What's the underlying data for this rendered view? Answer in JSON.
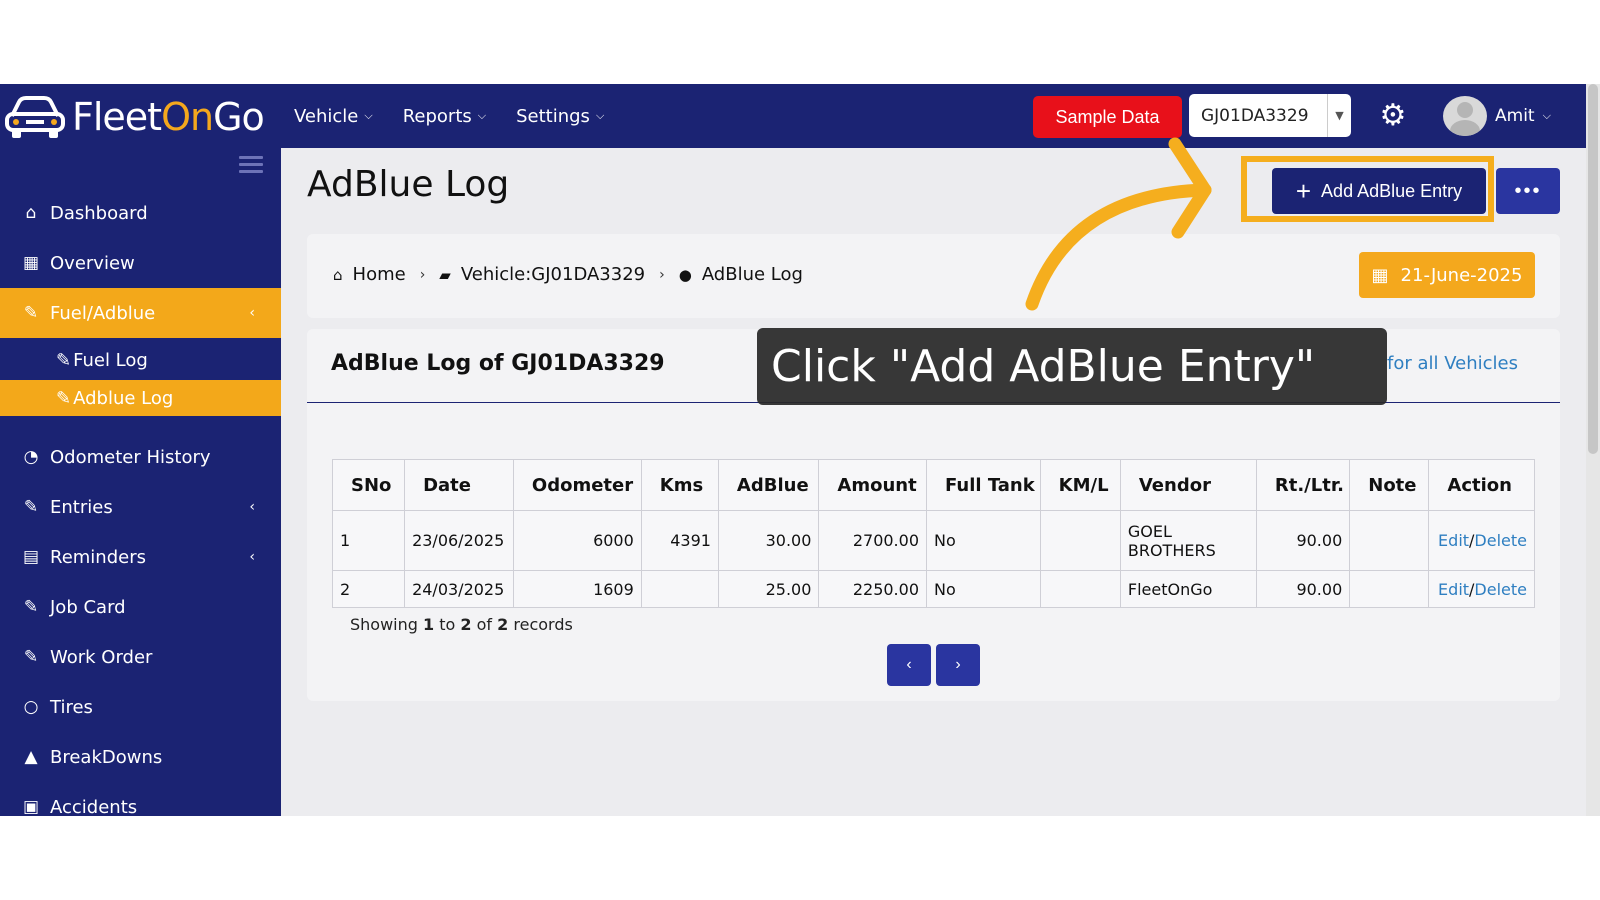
{
  "topbar": {
    "logo": {
      "part1": "Fleet",
      "part2": "On",
      "part3": "Go"
    },
    "nav": [
      {
        "label": "Vehicle"
      },
      {
        "label": "Reports"
      },
      {
        "label": "Settings"
      }
    ],
    "sample_data_label": "Sample Data",
    "vehicle_select": "GJ01DA3329",
    "user_name": "Amit"
  },
  "sidebar": {
    "items": [
      {
        "label": "Dashboard",
        "icon": "home-icon"
      },
      {
        "label": "Overview",
        "icon": "grid-icon"
      },
      {
        "label": "Fuel/Adblue",
        "icon": "edit-icon"
      },
      {
        "label": "Odometer History",
        "icon": "gauge-icon"
      },
      {
        "label": "Entries",
        "icon": "edit-icon"
      },
      {
        "label": "Reminders",
        "icon": "calendar-icon"
      },
      {
        "label": "Job Card",
        "icon": "edit-icon"
      },
      {
        "label": "Work Order",
        "icon": "edit-icon"
      },
      {
        "label": "Tires",
        "icon": "circle-icon"
      },
      {
        "label": "BreakDowns",
        "icon": "warning-icon"
      },
      {
        "label": "Accidents",
        "icon": "ambulance-icon"
      }
    ],
    "sub_items": [
      {
        "label": "Fuel Log"
      },
      {
        "label": "Adblue Log"
      }
    ]
  },
  "main": {
    "title": "AdBlue Log",
    "add_button": "Add AdBlue Entry",
    "more_button": "•••",
    "breadcrumb": {
      "home": "Home",
      "vehicle": "Vehicle:GJ01DA3329",
      "current": "AdBlue Log"
    },
    "date": "21-June-2025",
    "card_title": "AdBlue Log of GJ01DA3329",
    "card_link": "for all Vehicles",
    "table": {
      "headers": [
        "SNo",
        "Date",
        "Odometer",
        "Kms",
        "AdBlue",
        "Amount",
        "Full Tank",
        "KM/L",
        "Vendor",
        "Rt./Ltr.",
        "Note",
        "Action"
      ],
      "rows": [
        {
          "sno": "1",
          "date": "23/06/2025",
          "odometer": "6000",
          "kms": "4391",
          "adblue": "30.00",
          "amount": "2700.00",
          "full_tank": "No",
          "kml": "",
          "vendor_line1": "GOEL",
          "vendor_line2": "BROTHERS",
          "rate": "90.00",
          "note": "",
          "edit": "Edit",
          "delete": "Delete"
        },
        {
          "sno": "2",
          "date": "24/03/2025",
          "odometer": "1609",
          "kms": "",
          "adblue": "25.00",
          "amount": "2250.00",
          "full_tank": "No",
          "kml": "",
          "vendor_line1": "FleetOnGo",
          "vendor_line2": "",
          "rate": "90.00",
          "note": "",
          "edit": "Edit",
          "delete": "Delete"
        }
      ]
    },
    "records": {
      "prefix": "Showing",
      "from": "1",
      "to_word": "to",
      "to": "2",
      "of_word": "of",
      "total": "2",
      "suffix": "records"
    },
    "pager": {
      "prev": "‹",
      "next": "›"
    }
  },
  "tooltip": {
    "text": "Click \"Add AdBlue Entry\""
  },
  "colors": {
    "navy": "#1b2373",
    "accent": "#f3a81a",
    "red": "#e8101a",
    "link": "#2f7fc1"
  }
}
